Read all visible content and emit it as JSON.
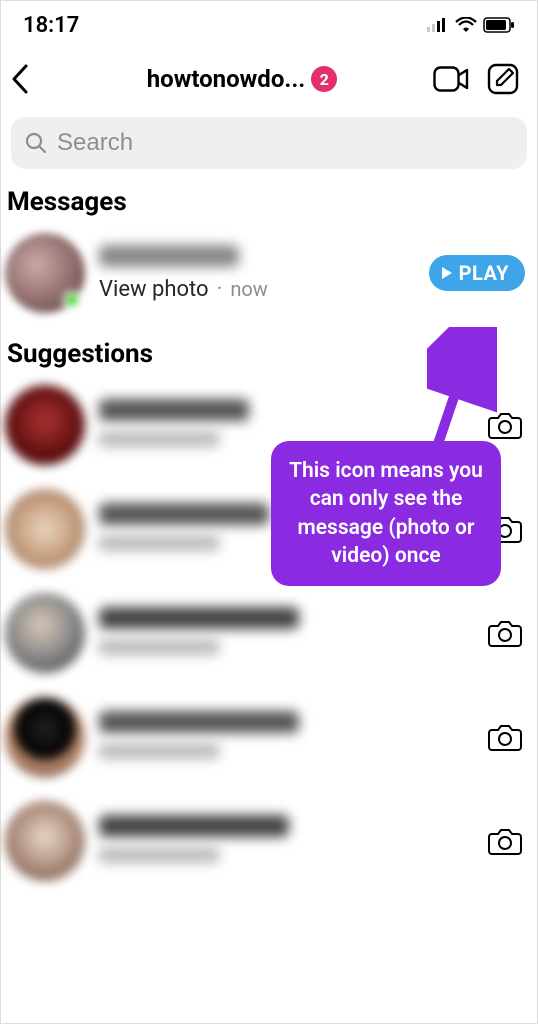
{
  "status": {
    "time": "18:17"
  },
  "header": {
    "title": "howtonowdo...",
    "badge": "2"
  },
  "search": {
    "placeholder": "Search"
  },
  "sections": {
    "messages_title": "Messages",
    "suggestions_title": "Suggestions"
  },
  "message": {
    "subtitle": "View photo",
    "time": "now",
    "play_label": "PLAY"
  },
  "callout": {
    "text": "This icon means you can only see the message (photo or video) once"
  }
}
